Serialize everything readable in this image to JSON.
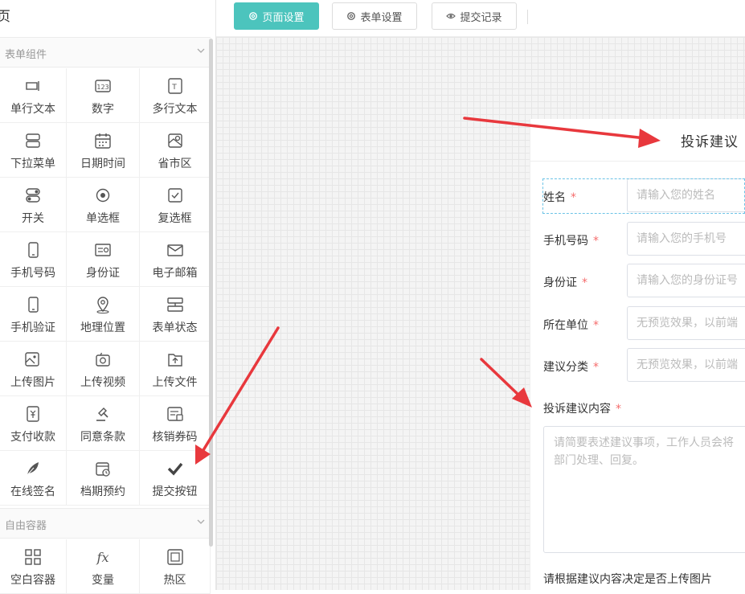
{
  "sidebar": {
    "title": "页",
    "form_section": "表单组件",
    "free_section": "自由容器",
    "form_items": [
      {
        "label": "单行文本",
        "icon": "single-line-text-icon"
      },
      {
        "label": "数字",
        "icon": "number-icon"
      },
      {
        "label": "多行文本",
        "icon": "multi-line-text-icon"
      },
      {
        "label": "下拉菜单",
        "icon": "dropdown-icon"
      },
      {
        "label": "日期时间",
        "icon": "calendar-icon"
      },
      {
        "label": "省市区",
        "icon": "region-map-icon"
      },
      {
        "label": "开关",
        "icon": "toggle-icon"
      },
      {
        "label": "单选框",
        "icon": "radio-icon"
      },
      {
        "label": "复选框",
        "icon": "checkbox-icon"
      },
      {
        "label": "手机号码",
        "icon": "mobile-phone-icon"
      },
      {
        "label": "身份证",
        "icon": "id-card-icon"
      },
      {
        "label": "电子邮箱",
        "icon": "email-icon"
      },
      {
        "label": "手机验证",
        "icon": "phone-verify-icon"
      },
      {
        "label": "地理位置",
        "icon": "location-pin-icon"
      },
      {
        "label": "表单状态",
        "icon": "form-status-icon"
      },
      {
        "label": "上传图片",
        "icon": "upload-image-icon"
      },
      {
        "label": "上传视频",
        "icon": "upload-video-icon"
      },
      {
        "label": "上传文件",
        "icon": "upload-file-icon"
      },
      {
        "label": "支付收款",
        "icon": "payment-icon"
      },
      {
        "label": "同意条款",
        "icon": "gavel-icon"
      },
      {
        "label": "核销券码",
        "icon": "coupon-icon"
      },
      {
        "label": "在线签名",
        "icon": "feather-icon"
      },
      {
        "label": "档期预约",
        "icon": "schedule-icon"
      },
      {
        "label": "提交按钮",
        "icon": "checkmark-icon"
      }
    ],
    "free_items": [
      {
        "label": "空白容器",
        "icon": "blank-container-icon"
      },
      {
        "label": "变量",
        "icon": "function-icon"
      },
      {
        "label": "热区",
        "icon": "hotspot-icon"
      }
    ]
  },
  "toolbar": {
    "page_settings": "页面设置",
    "form_settings": "表单设置",
    "submit_records": "提交记录"
  },
  "form": {
    "title": "投诉建议",
    "required_mark": "*",
    "fields": [
      {
        "label": "姓名",
        "placeholder": "请输入您的姓名"
      },
      {
        "label": "手机号码",
        "placeholder": "请输入您的手机号"
      },
      {
        "label": "身份证",
        "placeholder": "请输入您的身份证号"
      },
      {
        "label": "所在单位",
        "placeholder": "无预览效果，以前端"
      },
      {
        "label": "建议分类",
        "placeholder": "无预览效果，以前端"
      }
    ],
    "content_label": "投诉建议内容",
    "content_placeholder": "请简要表述建议事项，工作人员会将\n部门处理、回复。",
    "upload_label": "请根据建议内容决定是否上传图片"
  },
  "colors": {
    "accent": "#4cc4bd",
    "required": "#f56c6c",
    "arrow": "#e8383d"
  }
}
